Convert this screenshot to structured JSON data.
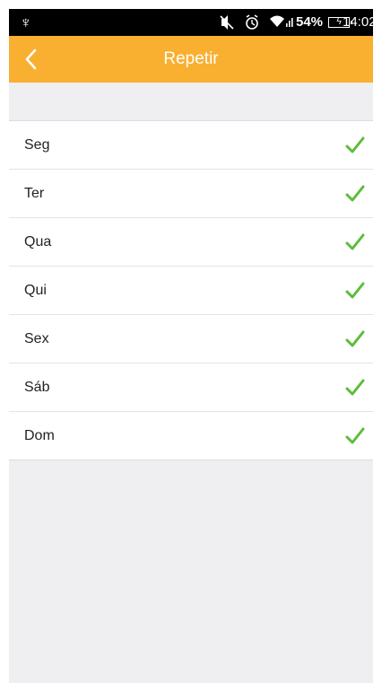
{
  "status_bar": {
    "usb_icon": "usb-icon",
    "mute_icon": "mute-icon",
    "alarm_icon": "alarm-icon",
    "wifi_icon": "wifi-signal-icon",
    "battery_percent": "54%",
    "battery_icon": "battery-charging-icon",
    "time": "14:02"
  },
  "app_bar": {
    "title": "Repetir",
    "back_icon": "chevron-left-icon",
    "color": "#f9af30"
  },
  "days": [
    {
      "label": "Seg",
      "checked": true
    },
    {
      "label": "Ter",
      "checked": true
    },
    {
      "label": "Qua",
      "checked": true
    },
    {
      "label": "Qui",
      "checked": true
    },
    {
      "label": "Sex",
      "checked": true
    },
    {
      "label": "Sáb",
      "checked": true
    },
    {
      "label": "Dom",
      "checked": true
    }
  ],
  "colors": {
    "check": "#5cbd3a",
    "background": "#efeff2"
  }
}
